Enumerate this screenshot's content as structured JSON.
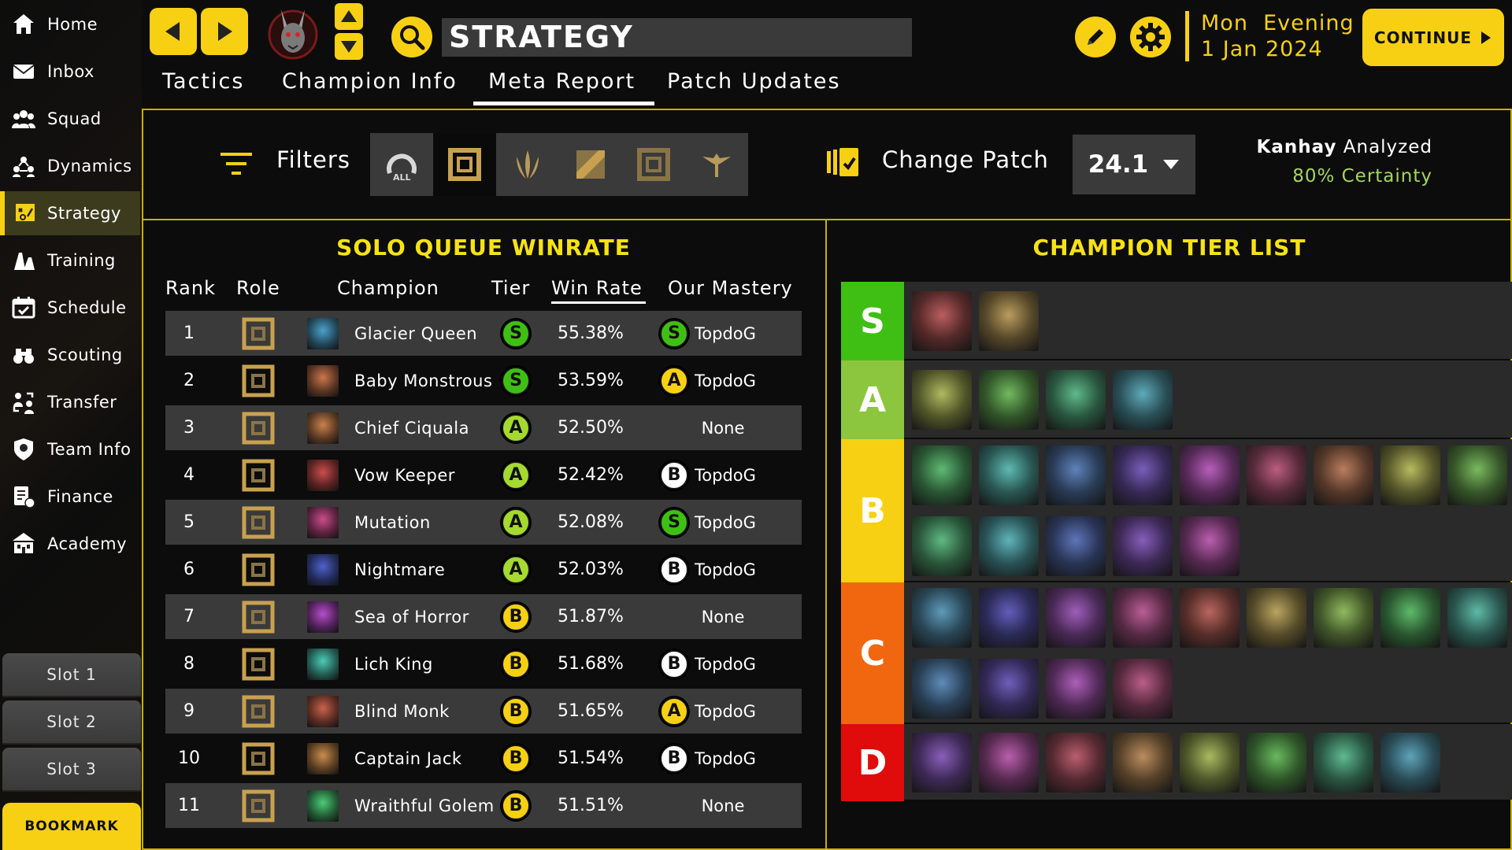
{
  "sidebar": {
    "items": [
      {
        "label": "Home",
        "icon": "home-icon"
      },
      {
        "label": "Inbox",
        "icon": "envelope-icon"
      },
      {
        "label": "Squad",
        "icon": "group-icon"
      },
      {
        "label": "Dynamics",
        "icon": "team-dynamics-icon"
      },
      {
        "label": "Strategy",
        "icon": "strategy-board-icon",
        "active": true
      },
      {
        "label": "Training",
        "icon": "cones-icon"
      },
      {
        "label": "Schedule",
        "icon": "calendar-icon"
      },
      {
        "label": "Scouting",
        "icon": "binoculars-icon"
      },
      {
        "label": "Transfer",
        "icon": "transfer-icon"
      },
      {
        "label": "Team Info",
        "icon": "team-badge-icon"
      },
      {
        "label": "Finance",
        "icon": "finance-icon"
      },
      {
        "label": "Academy",
        "icon": "academy-building-icon"
      }
    ],
    "slots": [
      "Slot 1",
      "Slot 2",
      "Slot 3"
    ],
    "bookmark": "BOOKMARK"
  },
  "header": {
    "title": "STRATEGY",
    "day": "Mon",
    "time_of_day": "Evening",
    "date": "1 Jan 2024",
    "continue_label": "CONTINUE"
  },
  "tabs": [
    {
      "label": "Tactics",
      "active": false
    },
    {
      "label": "Champion Info",
      "active": false
    },
    {
      "label": "Meta Report",
      "active": true
    },
    {
      "label": "Patch Updates",
      "active": false
    }
  ],
  "filters": {
    "label": "Filters",
    "role_buttons": [
      {
        "name": "role-all",
        "label": "ALL",
        "selected": false
      },
      {
        "name": "role-top",
        "selected": true
      },
      {
        "name": "role-jungle",
        "selected": false
      },
      {
        "name": "role-mid",
        "selected": false
      },
      {
        "name": "role-bot",
        "selected": false
      },
      {
        "name": "role-support",
        "selected": false
      }
    ],
    "change_patch_label": "Change Patch",
    "patch_value": "24.1",
    "analyst_name": "Kanhay",
    "analyst_suffix": "Analyzed",
    "certainty": "80% Certainty"
  },
  "winrate": {
    "title": "SOLO QUEUE WINRATE",
    "columns": [
      "Rank",
      "Role",
      "Champion",
      "Tier",
      "Win Rate",
      "Our Mastery"
    ],
    "rows": [
      {
        "rank": "1",
        "champion": "Glacier Queen",
        "tier": "S",
        "win_rate": "55.38%",
        "mastery_tier": "S",
        "mastery": "TopdoG"
      },
      {
        "rank": "2",
        "champion": "Baby Monstrous",
        "tier": "S",
        "win_rate": "53.59%",
        "mastery_tier": "A",
        "mastery": "TopdoG"
      },
      {
        "rank": "3",
        "champion": "Chief Ciquala",
        "tier": "A",
        "win_rate": "52.50%",
        "mastery_tier": "",
        "mastery": "None"
      },
      {
        "rank": "4",
        "champion": "Vow Keeper",
        "tier": "A",
        "win_rate": "52.42%",
        "mastery_tier": "B",
        "mastery": "TopdoG"
      },
      {
        "rank": "5",
        "champion": "Mutation",
        "tier": "A",
        "win_rate": "52.08%",
        "mastery_tier": "S",
        "mastery": "TopdoG"
      },
      {
        "rank": "6",
        "champion": "Nightmare",
        "tier": "A",
        "win_rate": "52.03%",
        "mastery_tier": "B",
        "mastery": "TopdoG"
      },
      {
        "rank": "7",
        "champion": "Sea of Horror",
        "tier": "B",
        "win_rate": "51.87%",
        "mastery_tier": "",
        "mastery": "None"
      },
      {
        "rank": "8",
        "champion": "Lich King",
        "tier": "B",
        "win_rate": "51.68%",
        "mastery_tier": "B",
        "mastery": "TopdoG"
      },
      {
        "rank": "9",
        "champion": "Blind Monk",
        "tier": "B",
        "win_rate": "51.65%",
        "mastery_tier": "A",
        "mastery": "TopdoG"
      },
      {
        "rank": "10",
        "champion": "Captain Jack",
        "tier": "B",
        "win_rate": "51.54%",
        "mastery_tier": "B",
        "mastery": "TopdoG"
      },
      {
        "rank": "11",
        "champion": "Wraithful Golem",
        "tier": "B",
        "win_rate": "51.51%",
        "mastery_tier": "",
        "mastery": "None"
      }
    ]
  },
  "tier_list": {
    "title": "CHAMPION TIER LIST",
    "tiers": [
      {
        "tier": "S",
        "color": "#3fbf14",
        "count": 2
      },
      {
        "tier": "A",
        "color": "#8cc63f",
        "count": 4
      },
      {
        "tier": "B",
        "color": "#f7d014",
        "count": 14
      },
      {
        "tier": "C",
        "color": "#f0670f",
        "count": 13
      },
      {
        "tier": "D",
        "color": "#e00b0b",
        "count": 8
      }
    ]
  },
  "colors": {
    "accent": "#f7d014",
    "tier_S": "#3fbf14",
    "tier_A": "#a4d92f",
    "tier_B": "#f7d014",
    "mastery_B": "#ffffff",
    "certainty": "#a4d65e"
  }
}
